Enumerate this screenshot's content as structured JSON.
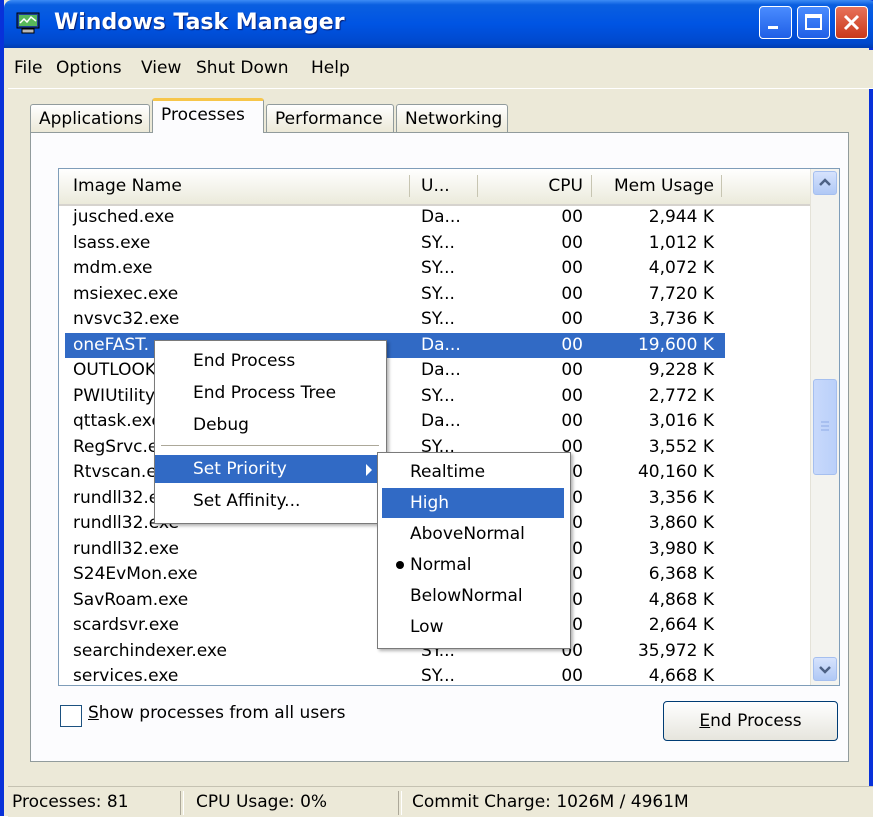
{
  "window": {
    "title": "Windows Task Manager"
  },
  "menu": [
    "File",
    "Options",
    "View",
    "Shut Down",
    "Help"
  ],
  "tabs": [
    "Applications",
    "Processes",
    "Performance",
    "Networking"
  ],
  "columns": {
    "name": "Image Name",
    "user": "U...",
    "cpu": "CPU",
    "mem": "Mem Usage"
  },
  "processes": [
    {
      "name": "jusched.exe",
      "user": "Da...",
      "cpu": "00",
      "mem": "2,944 K"
    },
    {
      "name": "lsass.exe",
      "user": "SY...",
      "cpu": "00",
      "mem": "1,012 K"
    },
    {
      "name": "mdm.exe",
      "user": "SY...",
      "cpu": "00",
      "mem": "4,072 K"
    },
    {
      "name": "msiexec.exe",
      "user": "SY...",
      "cpu": "00",
      "mem": "7,720 K"
    },
    {
      "name": "nvsvc32.exe",
      "user": "SY...",
      "cpu": "00",
      "mem": "3,736 K"
    },
    {
      "name": "oneFAST.",
      "user": "Da...",
      "cpu": "00",
      "mem": "19,600 K"
    },
    {
      "name": "OUTLOOK",
      "user": "Da...",
      "cpu": "00",
      "mem": "9,228 K"
    },
    {
      "name": "PWIUtility",
      "user": "SY...",
      "cpu": "00",
      "mem": "2,772 K"
    },
    {
      "name": "qttask.exe",
      "user": "Da...",
      "cpu": "00",
      "mem": "3,016 K"
    },
    {
      "name": "RegSrvc.e",
      "user": "SY...",
      "cpu": "00",
      "mem": "3,552 K"
    },
    {
      "name": "Rtvscan.e",
      "user": "",
      "cpu": "0",
      "mem": "40,160 K"
    },
    {
      "name": "rundll32.e",
      "user": "",
      "cpu": "0",
      "mem": "3,356 K"
    },
    {
      "name": "rundll32.exe",
      "user": "",
      "cpu": "0",
      "mem": "3,860 K"
    },
    {
      "name": "rundll32.exe",
      "user": "",
      "cpu": "0",
      "mem": "3,980 K"
    },
    {
      "name": "S24EvMon.exe",
      "user": "",
      "cpu": "0",
      "mem": "6,368 K"
    },
    {
      "name": "SavRoam.exe",
      "user": "",
      "cpu": "0",
      "mem": "4,868 K"
    },
    {
      "name": "scardsvr.exe",
      "user": "",
      "cpu": "0",
      "mem": "2,664 K"
    },
    {
      "name": "searchindexer.exe",
      "user": "SY...",
      "cpu": "00",
      "mem": "35,972 K"
    },
    {
      "name": "services.exe",
      "user": "SY...",
      "cpu": "00",
      "mem": "4,668 K"
    }
  ],
  "selected_index": 5,
  "context_menu": {
    "end_process": "End Process",
    "end_process_tree": "End Process Tree",
    "debug": "Debug",
    "set_priority": "Set Priority",
    "set_affinity": "Set Affinity..."
  },
  "priority_menu": [
    "Realtime",
    "High",
    "AboveNormal",
    "Normal",
    "BelowNormal",
    "Low"
  ],
  "priority_highlighted": "High",
  "priority_checked": "Normal",
  "checkbox": {
    "label_first": "S",
    "label_rest": "how processes from all users",
    "checked": false
  },
  "end_button": {
    "label_first": "E",
    "label_rest": "nd Process"
  },
  "status": {
    "processes": "Processes: 81",
    "cpu": "CPU Usage: 0%",
    "commit": "Commit Charge: 1026M / 4961M"
  }
}
